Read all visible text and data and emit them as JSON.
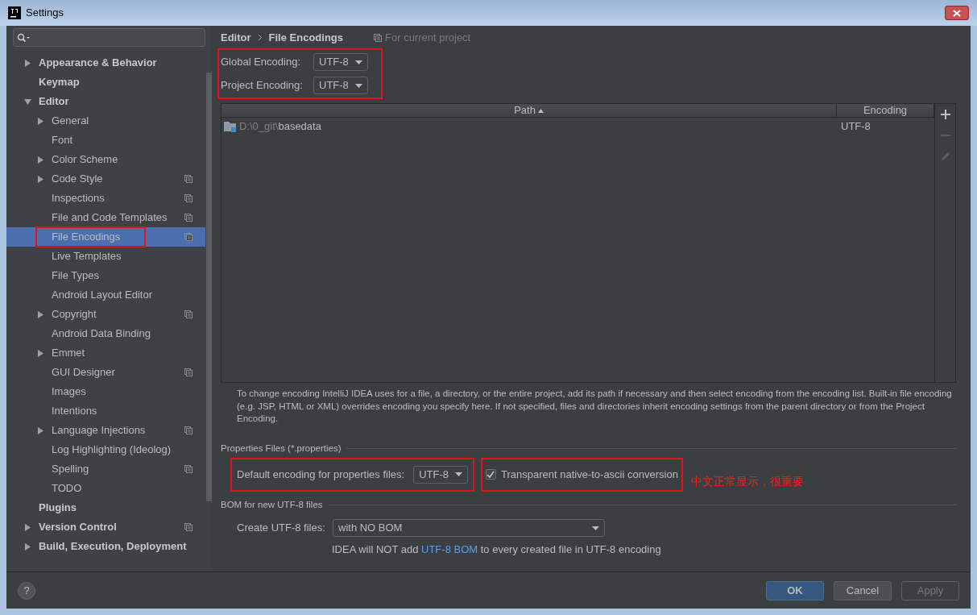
{
  "window": {
    "title": "Settings"
  },
  "sidebar": {
    "items": [
      {
        "label": "Appearance & Behavior",
        "kind": "folder",
        "expanded": false,
        "scoped": false,
        "selected": false,
        "highlight": false
      },
      {
        "label": "Keymap",
        "kind": "leaf",
        "scoped": false,
        "selected": false,
        "highlight": false
      },
      {
        "label": "Editor",
        "kind": "folder",
        "expanded": true,
        "scoped": false,
        "selected": false,
        "highlight": false,
        "children": [
          {
            "label": "General",
            "kind": "folder",
            "expanded": false,
            "scoped": false,
            "selected": false,
            "highlight": false
          },
          {
            "label": "Font",
            "kind": "leaf",
            "scoped": false,
            "selected": false,
            "highlight": false
          },
          {
            "label": "Color Scheme",
            "kind": "folder",
            "expanded": false,
            "scoped": false,
            "selected": false,
            "highlight": false
          },
          {
            "label": "Code Style",
            "kind": "folder",
            "expanded": false,
            "scoped": true,
            "selected": false,
            "highlight": false
          },
          {
            "label": "Inspections",
            "kind": "leaf",
            "scoped": true,
            "selected": false,
            "highlight": false
          },
          {
            "label": "File and Code Templates",
            "kind": "leaf",
            "scoped": true,
            "selected": false,
            "highlight": false
          },
          {
            "label": "File Encodings",
            "kind": "leaf",
            "scoped": true,
            "selected": true,
            "highlight": true
          },
          {
            "label": "Live Templates",
            "kind": "leaf",
            "scoped": false,
            "selected": false,
            "highlight": false
          },
          {
            "label": "File Types",
            "kind": "leaf",
            "scoped": false,
            "selected": false,
            "highlight": false
          },
          {
            "label": "Android Layout Editor",
            "kind": "leaf",
            "scoped": false,
            "selected": false,
            "highlight": false
          },
          {
            "label": "Copyright",
            "kind": "folder",
            "expanded": false,
            "scoped": true,
            "selected": false,
            "highlight": false
          },
          {
            "label": "Android Data Binding",
            "kind": "leaf",
            "scoped": false,
            "selected": false,
            "highlight": false
          },
          {
            "label": "Emmet",
            "kind": "folder",
            "expanded": false,
            "scoped": false,
            "selected": false,
            "highlight": false
          },
          {
            "label": "GUI Designer",
            "kind": "leaf",
            "scoped": true,
            "selected": false,
            "highlight": false
          },
          {
            "label": "Images",
            "kind": "leaf",
            "scoped": false,
            "selected": false,
            "highlight": false
          },
          {
            "label": "Intentions",
            "kind": "leaf",
            "scoped": false,
            "selected": false,
            "highlight": false
          },
          {
            "label": "Language Injections",
            "kind": "folder",
            "expanded": false,
            "scoped": true,
            "selected": false,
            "highlight": false
          },
          {
            "label": "Log Highlighting (Ideolog)",
            "kind": "leaf",
            "scoped": false,
            "selected": false,
            "highlight": false
          },
          {
            "label": "Spelling",
            "kind": "leaf",
            "scoped": true,
            "selected": false,
            "highlight": false
          },
          {
            "label": "TODO",
            "kind": "leaf",
            "scoped": false,
            "selected": false,
            "highlight": false
          }
        ]
      },
      {
        "label": "Plugins",
        "kind": "leaf",
        "scoped": false,
        "selected": false,
        "highlight": false
      },
      {
        "label": "Version Control",
        "kind": "folder",
        "expanded": false,
        "scoped": true,
        "selected": false,
        "highlight": false
      },
      {
        "label": "Build, Execution, Deployment",
        "kind": "folder",
        "expanded": false,
        "scoped": false,
        "selected": false,
        "highlight": false
      }
    ]
  },
  "breadcrumb": {
    "items": [
      "Editor",
      "File Encodings"
    ],
    "scope": "For current project"
  },
  "encodings": {
    "highlight": true,
    "fields": [
      {
        "label": "Global Encoding:",
        "value": "UTF-8"
      },
      {
        "label": "Project Encoding:",
        "value": "UTF-8"
      }
    ]
  },
  "table": {
    "columns": [
      {
        "label": "Path",
        "sorted": true
      },
      {
        "label": "Encoding",
        "sorted": false
      }
    ],
    "rows": [
      {
        "path_prefix": "D:\\0_git\\",
        "path_name": "basedata",
        "encoding": "UTF-8"
      }
    ],
    "tools": [
      {
        "kind": "add",
        "disabled": false
      },
      {
        "kind": "remove",
        "disabled": true
      },
      {
        "kind": "edit",
        "disabled": true
      }
    ]
  },
  "description": "To change encoding IntelliJ IDEA uses for a file, a directory, or the entire project, add its path if necessary and then select encoding from the encoding list. Built-in file encoding (e.g. JSP, HTML or XML) overrides encoding you specify here. If not specified, files and directories inherit encoding settings from the parent directory or from the Project Encoding.",
  "properties": {
    "title": "Properties Files (*.properties)",
    "default_label": "Default encoding for properties files:",
    "default_value": "UTF-8",
    "default_highlight": true,
    "transparent_label": "Transparent native-to-ascii conversion",
    "transparent_checked": true,
    "transparent_highlight": true,
    "note": "中文正常显示，很重要"
  },
  "bom": {
    "title": "BOM for new UTF-8 files",
    "label": "Create UTF-8 files:",
    "value": "with NO BOM",
    "hint_before": "IDEA will NOT add ",
    "hint_link": "UTF-8 BOM",
    "hint_after": " to every created file in UTF-8 encoding"
  },
  "help": "?",
  "buttons": [
    {
      "label": "OK",
      "kind": "default",
      "disabled": false
    },
    {
      "label": "Cancel",
      "kind": "normal",
      "disabled": false
    },
    {
      "label": "Apply",
      "kind": "normal",
      "disabled": true
    }
  ]
}
